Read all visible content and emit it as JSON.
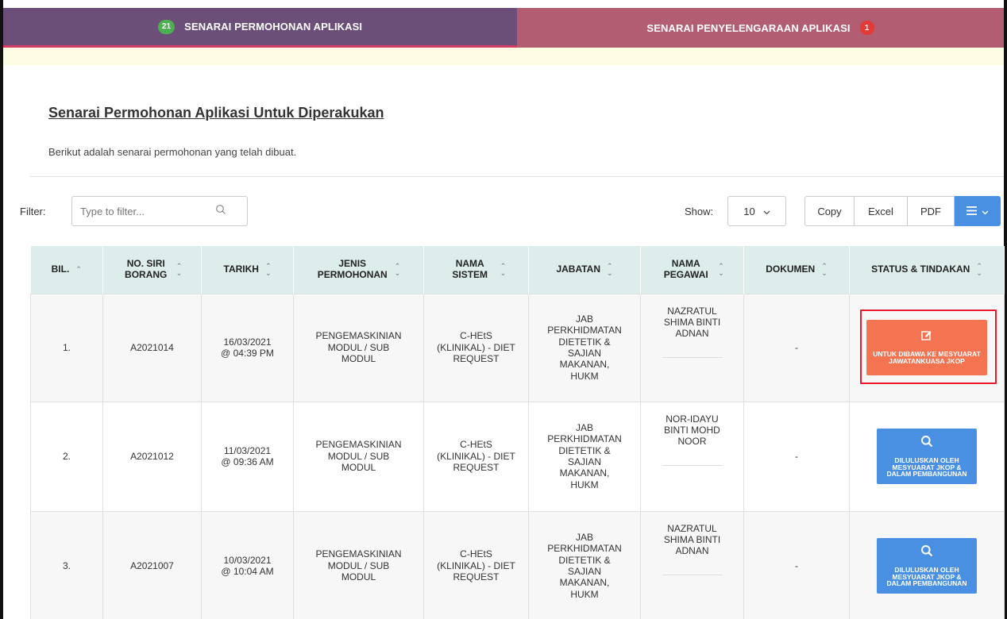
{
  "tabs": {
    "left": {
      "badge": "21",
      "label": "SENARAI PERMOHONAN APLIKASI"
    },
    "right": {
      "badge": "1",
      "label": "SENARAI PENYELENGARAAN APLIKASI"
    }
  },
  "page": {
    "title": "Senarai Permohonan Aplikasi Untuk Diperakukan",
    "subtitle": "Berikut adalah senarai permohonan yang telah dibuat."
  },
  "toolbar": {
    "filter_label": "Filter:",
    "filter_placeholder": "Type to filter...",
    "show_label": "Show:",
    "show_value": "10",
    "copy_label": "Copy",
    "excel_label": "Excel",
    "pdf_label": "PDF"
  },
  "table": {
    "headers": {
      "bil": "BIL.",
      "no_siri": "NO. SIRI BORANG",
      "tarikh": "TARIKH",
      "jenis": "JENIS PERMOHONAN",
      "nama_sistem": "NAMA SISTEM",
      "jabatan": "JABATAN",
      "nama_pegawai": "NAMA PEGAWAI",
      "dokumen": "DOKUMEN",
      "status": "STATUS & TINDAKAN"
    },
    "rows": [
      {
        "bil": "1.",
        "no_siri": "A2021014",
        "tarikh": "16/03/2021 @ 04:39 PM",
        "jenis": "PENGEMASKINIAN MODUL / SUB MODUL",
        "nama_sistem": "C-HEtS (KLINIKAL) - DIET REQUEST",
        "jabatan": "JAB PERKHIDMATAN DIETETIK & SAJIAN MAKANAN, HUKM",
        "nama_pegawai": "NAZRATUL SHIMA BINTI ADNAN",
        "dokumen": "-",
        "status": "UNTUK DIBAWA KE MESYUARAT JAWATANKUASA JKOP",
        "status_color": "#f47351",
        "status_icon": "edit-icon"
      },
      {
        "bil": "2.",
        "no_siri": "A2021012",
        "tarikh": "11/03/2021 @ 09:36 AM",
        "jenis": "PENGEMASKINIAN MODUL / SUB MODUL",
        "nama_sistem": "C-HEtS (KLINIKAL) - DIET REQUEST",
        "jabatan": "JAB PERKHIDMATAN DIETETIK & SAJIAN MAKANAN, HUKM",
        "nama_pegawai": "NOR-IDAYU BINTI MOHD NOOR",
        "dokumen": "-",
        "status": "DILULUSKAN OLEH MESYUARAT JKOP & DALAM PEMBANGUNAN",
        "status_color": "#4a90e2",
        "status_icon": "search-icon"
      },
      {
        "bil": "3.",
        "no_siri": "A2021007",
        "tarikh": "10/03/2021 @ 10:04 AM",
        "jenis": "PENGEMASKINIAN MODUL / SUB MODUL",
        "nama_sistem": "C-HEtS (KLINIKAL) - DIET REQUEST",
        "jabatan": "JAB PERKHIDMATAN DIETETIK & SAJIAN MAKANAN, HUKM",
        "nama_pegawai": "NAZRATUL SHIMA BINTI ADNAN",
        "dokumen": "-",
        "status": "DILULUSKAN OLEH MESYUARAT JKOP & DALAM PEMBANGUNAN",
        "status_color": "#4a90e2",
        "status_icon": "search-icon"
      }
    ]
  },
  "colors": {
    "tab_left_bg": "#6b4f78",
    "tab_right_bg": "#b35d72",
    "header_bg": "#dcedeb",
    "action_orange": "#f47351",
    "action_blue": "#4a90e2",
    "highlight_red": "#e8192c"
  }
}
